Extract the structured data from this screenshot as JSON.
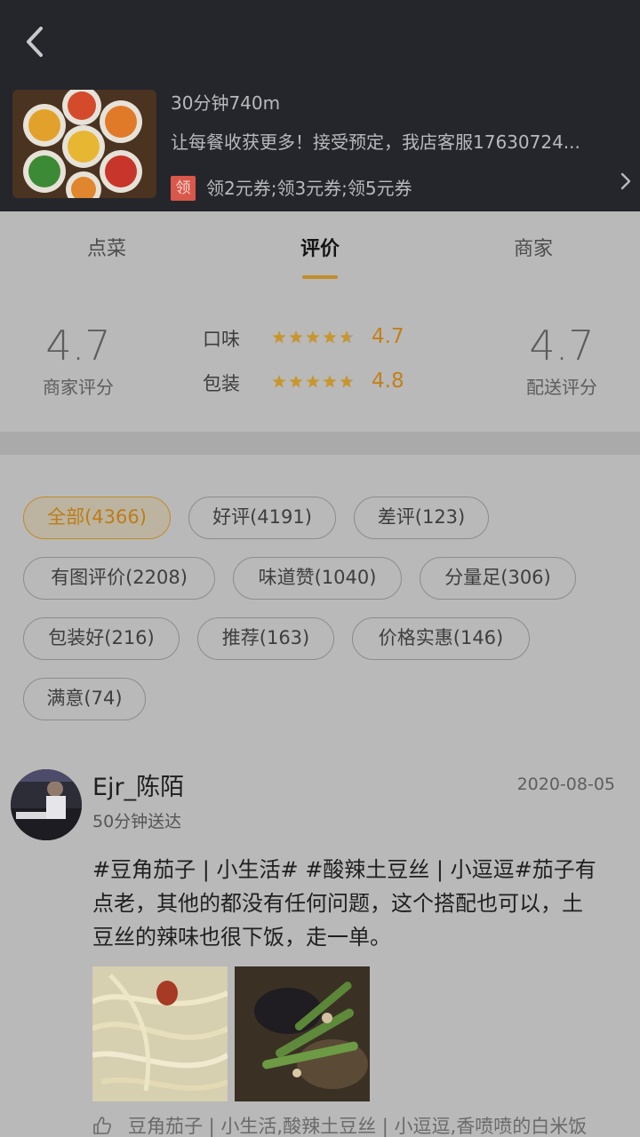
{
  "header": {
    "line1": "30分钟740m",
    "line2": "让每餐收获更多！接受预定，我店客服17630724...",
    "coupon_badge": "领",
    "coupons": "领2元券;领3元券;领5元券"
  },
  "tabs": [
    {
      "label": "点菜"
    },
    {
      "label": "评价",
      "active": true
    },
    {
      "label": "商家"
    }
  ],
  "scores": {
    "merchant_score": "4.7",
    "merchant_label": "商家评分",
    "taste_label": "口味",
    "taste_stars": 4.7,
    "taste_value": "4.7",
    "package_label": "包装",
    "package_stars": 4.8,
    "package_value": "4.8",
    "delivery_score": "4.7",
    "delivery_label": "配送评分"
  },
  "filters": [
    {
      "label": "全部(4366)",
      "selected": true
    },
    {
      "label": "好评(4191)"
    },
    {
      "label": "差评(123)"
    },
    {
      "label": "有图评价(2208)"
    },
    {
      "label": "味道赞(1040)"
    },
    {
      "label": "分量足(306)"
    },
    {
      "label": "包装好(216)"
    },
    {
      "label": "推荐(163)"
    },
    {
      "label": "价格实惠(146)"
    },
    {
      "label": "满意(74)"
    }
  ],
  "review": {
    "user": "Ejr_陈陌",
    "delivery_time": "50分钟送达",
    "date": "2020-08-05",
    "text": "#豆角茄子 | 小生活# #酸辣土豆丝 | 小逗逗#茄子有点老，其他的都没有任何问题，这个搭配也可以，土豆丝的辣味也很下饭，走一单。",
    "tags": "豆角茄子 | 小生活,酸辣土豆丝 | 小逗逗,香喷喷的白米饭"
  },
  "colors": {
    "header_bg": "#25262b",
    "accent": "#c38d28",
    "rating": "#c2801d",
    "page_bg": "#b9b9b9"
  },
  "icons": [
    "back-arrow-icon",
    "chevron-right-icon",
    "star-icon",
    "thumbs-up-icon"
  ]
}
